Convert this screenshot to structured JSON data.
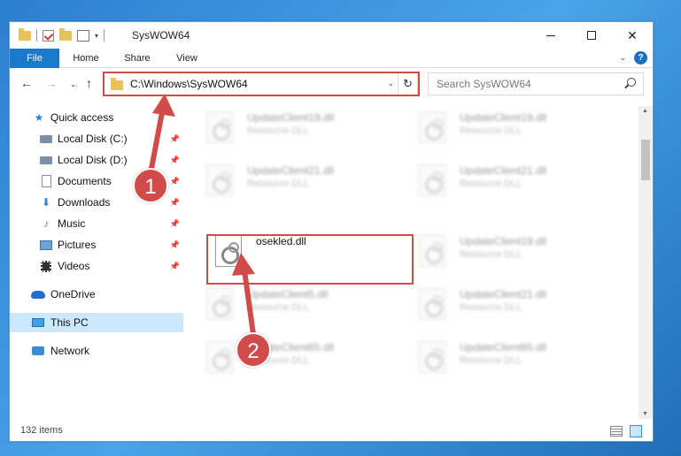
{
  "window": {
    "title": "SysWOW64"
  },
  "ribbon": {
    "tabs": [
      "File",
      "Home",
      "Share",
      "View"
    ],
    "help": "?"
  },
  "address": {
    "path": "C:\\Windows\\SysWOW64"
  },
  "search": {
    "placeholder": "Search SysWOW64"
  },
  "sidebar": {
    "items": [
      {
        "label": "Quick access",
        "icon": "star-icon",
        "pinned": false
      },
      {
        "label": "Local Disk (C:)",
        "icon": "drive-icon",
        "pinned": true
      },
      {
        "label": "Local Disk (D:)",
        "icon": "drive-icon",
        "pinned": true
      },
      {
        "label": "Documents",
        "icon": "documents-icon",
        "pinned": true
      },
      {
        "label": "Downloads",
        "icon": "download-icon",
        "pinned": true
      },
      {
        "label": "Music",
        "icon": "music-icon",
        "pinned": true
      },
      {
        "label": "Pictures",
        "icon": "pictures-icon",
        "pinned": true
      },
      {
        "label": "Videos",
        "icon": "videos-icon",
        "pinned": true
      },
      {
        "label": "OneDrive",
        "icon": "onedrive-icon",
        "pinned": false
      },
      {
        "label": "This PC",
        "icon": "pc-icon",
        "pinned": false,
        "selected": true
      },
      {
        "label": "Network",
        "icon": "network-icon",
        "pinned": false
      }
    ]
  },
  "files": {
    "left": [
      {
        "name": "UpdateClient19.dll",
        "type": "Resource DLL"
      },
      {
        "name": "UpdateClient21.dll",
        "type": "Resource DLL"
      },
      {
        "name": "osekled.dll",
        "type": ""
      },
      {
        "name": "UpdateClient5.dll",
        "type": "Resource DLL"
      },
      {
        "name": "UpdateClient65.dll",
        "type": "Resource DLL"
      }
    ],
    "right": [
      {
        "name": "UpdateClient19.dll",
        "type": "Resource DLL"
      },
      {
        "name": "UpdateClient21.dll",
        "type": "Resource DLL"
      },
      {
        "name": "UpdateClient19.dll",
        "type": "Resource DLL"
      },
      {
        "name": "UpdateClient21.dll",
        "type": "Resource DLL"
      },
      {
        "name": "UpdateClient65.dll",
        "type": "Resource DLL"
      }
    ]
  },
  "status": {
    "count": "132 items"
  },
  "callouts": {
    "one": "1",
    "two": "2"
  },
  "colors": {
    "accent": "#1979ca",
    "highlight": "#d24b4b",
    "selected": "#cce8ff"
  }
}
